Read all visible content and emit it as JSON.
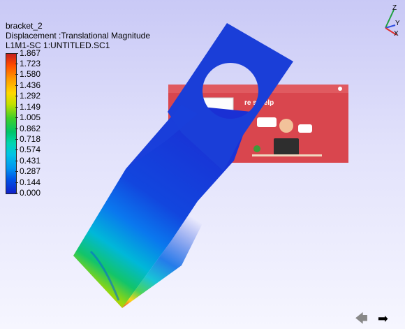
{
  "header": {
    "model_name": "bracket_2",
    "result": "Displacement :Translational Magnitude",
    "load_case": "L1M1-SC 1:UNTITLED.SC1"
  },
  "legend": {
    "values": [
      "1.867",
      "1.723",
      "1.580",
      "1.436",
      "1.292",
      "1.149",
      "1.005",
      "0.862",
      "0.718",
      "0.574",
      "0.431",
      "0.287",
      "0.144",
      "0.000"
    ],
    "top_color": "#c41e1e",
    "bottom_color": "#1020c8"
  },
  "triad": {
    "z": "Z",
    "y": "Y",
    "x": "X"
  },
  "overlay_card": {
    "heading": "re  s Help",
    "bg_color": "#d9464e"
  },
  "navigation": {
    "back_icon": "arrow-left-icon",
    "forward_icon": "arrow-right-icon"
  }
}
